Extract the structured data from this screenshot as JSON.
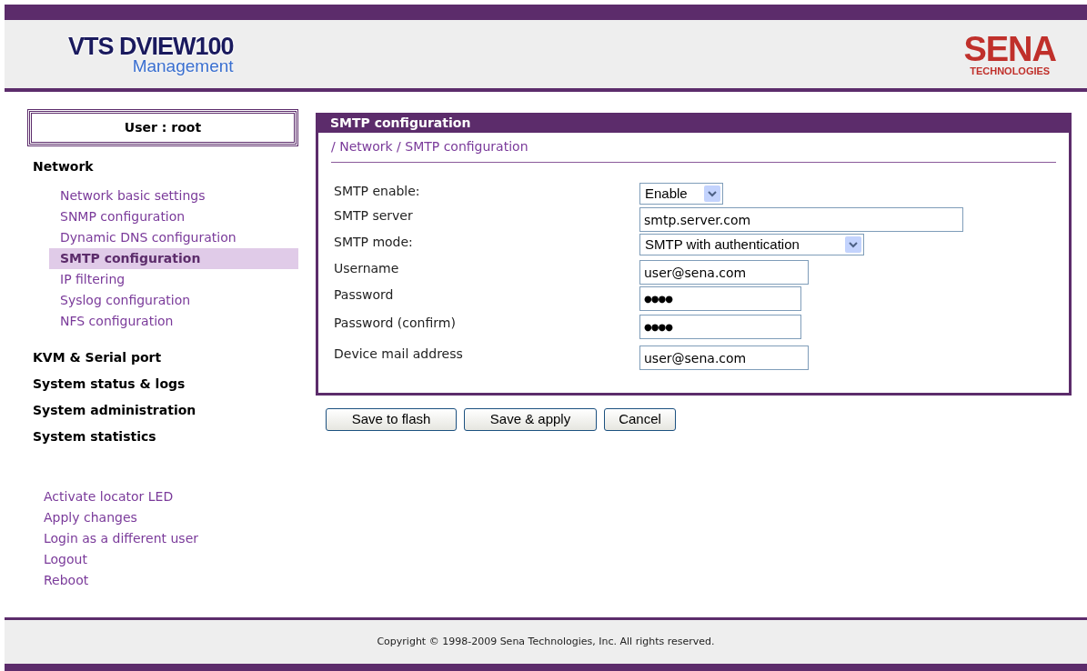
{
  "header": {
    "product": "VTS DVIEW100",
    "subtitle": "Management",
    "brand": "SENA",
    "brand_sub": "TECHNOLOGIES"
  },
  "sidebar": {
    "user": "User : root",
    "sections": [
      {
        "label": "Network",
        "children": [
          {
            "label": "Network basic settings",
            "selected": false
          },
          {
            "label": "SNMP configuration",
            "selected": false
          },
          {
            "label": "Dynamic DNS configuration",
            "selected": false
          },
          {
            "label": "SMTP configuration",
            "selected": true
          },
          {
            "label": "IP filtering",
            "selected": false
          },
          {
            "label": "Syslog configuration",
            "selected": false
          },
          {
            "label": "NFS configuration",
            "selected": false
          }
        ]
      },
      {
        "label": "KVM & Serial port"
      },
      {
        "label": "System status & logs"
      },
      {
        "label": "System administration"
      },
      {
        "label": "System statistics"
      }
    ],
    "links": [
      "Activate locator LED",
      "Apply changes",
      "Login as a different user",
      "Logout",
      "Reboot"
    ]
  },
  "panel": {
    "title": "SMTP configuration",
    "breadcrumb": "/ Network / SMTP configuration",
    "fields": [
      {
        "label": "SMTP enable:",
        "kind": "select",
        "value": "Enable"
      },
      {
        "label": "SMTP server",
        "kind": "text",
        "value": "smtp.server.com"
      },
      {
        "label": "SMTP mode:",
        "kind": "select",
        "value": "SMTP with authentication"
      },
      {
        "label": "Username",
        "kind": "text",
        "value": "user@sena.com"
      },
      {
        "label": "Password",
        "kind": "password",
        "value": "●●●●"
      },
      {
        "label": "Password (confirm)",
        "kind": "password",
        "value": "●●●●"
      },
      {
        "label": "Device mail address",
        "kind": "text",
        "value": "user@sena.com"
      }
    ]
  },
  "buttons": [
    "Save to flash",
    "Save & apply",
    "Cancel"
  ],
  "footer": "Copyright © 1998-2009 Sena Technologies, Inc. All rights reserved."
}
